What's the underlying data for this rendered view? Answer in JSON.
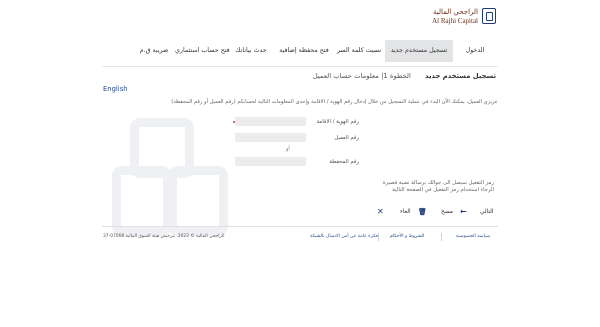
{
  "brand": {
    "name_ar": "الراجحي المالية",
    "name_en": "Al Rajhi Capital"
  },
  "nav": {
    "items": [
      {
        "label": "الدخول"
      },
      {
        "label": "تسجيل مستخدم جديد"
      },
      {
        "label": "نسيت كلمة السر"
      },
      {
        "label": "فتح محفظة إضافية"
      },
      {
        "label": "حدث بياناتك"
      },
      {
        "label": "فتح حساب استثماري"
      },
      {
        "label": "ضريبة ق.م"
      }
    ],
    "language": "English"
  },
  "form": {
    "title": "تسجيل مستخدم جديد",
    "step": "الخطوة 1| معلومات حساب العميل",
    "intro": "عزيزي العميل، يمكنك الآن البدء في عملية التسجيل من خلال إدخال رقم الهوية / الاقامة وإحدى المعلومات التالية لحسابكم (رقم العميل أو رقم المحفظة)",
    "fields": {
      "id_label": "رقم الهوية / الاقامة",
      "customer_label": "رقم العميل",
      "or_label": "أو",
      "portfolio_label": "رقم المحفظة"
    },
    "notes": [
      "رمز التفعيل سيصل الى جوالك برسالة نصية قصيرة",
      "الرجاء استخدام رمز التفعيل في الصفحة التالية"
    ],
    "actions": {
      "next": "التالي",
      "clear": "مسح",
      "cancel": "الغاء"
    }
  },
  "footer": {
    "links": [
      {
        "label": "سياسة الخصوصية"
      },
      {
        "label": "الشروط و الأحكام"
      },
      {
        "label": "فكرة عامة عن أمن الاتصال بالشبكة"
      }
    ],
    "copyright": "الراجحي المالية © 2022. بترخيص هيئة السوق المالية 07068-37"
  }
}
